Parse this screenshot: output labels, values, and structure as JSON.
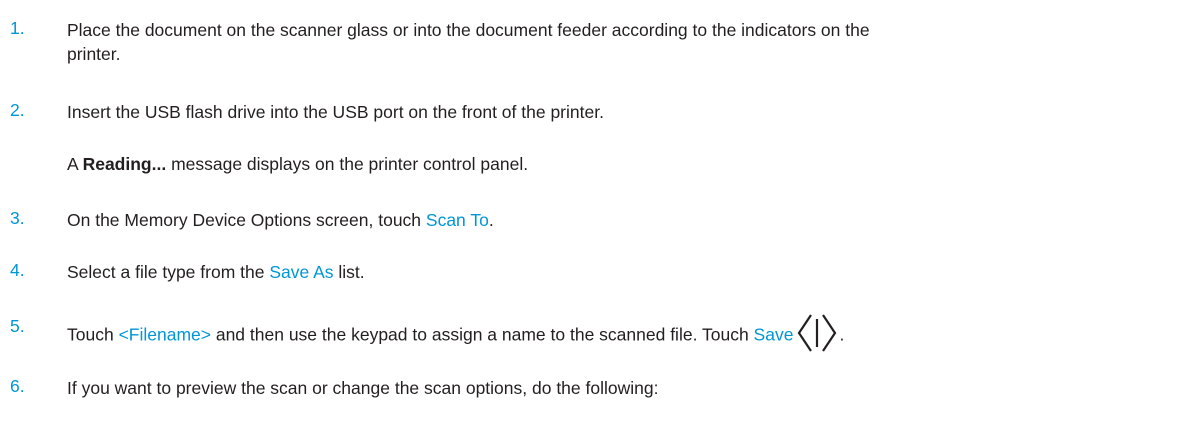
{
  "steps": [
    {
      "number": "1.",
      "text_line1": "Place the document on the scanner glass or into the document feeder according to the indicators on the",
      "text_line2": "printer."
    },
    {
      "number": "2.",
      "text": "Insert the USB flash drive into the USB port on the front of the printer.",
      "note_prefix": "A ",
      "note_bold": "Reading...",
      "note_suffix": " message displays on the printer control panel."
    },
    {
      "number": "3.",
      "text_prefix": "On the Memory Device Options screen, touch ",
      "ui_term": "Scan To",
      "text_suffix": "."
    },
    {
      "number": "4.",
      "text_prefix": "Select a file type from the ",
      "ui_term": "Save As",
      "text_suffix": " list."
    },
    {
      "number": "5.",
      "text_prefix": "Touch ",
      "ui_term1": "<Filename>",
      "text_middle": " and then use the keypad to assign a name to the scanned file. Touch ",
      "ui_term2": "Save",
      "icon": "start-button-icon",
      "text_suffix": "."
    },
    {
      "number": "6.",
      "text": "If you want to preview the scan or change the scan options, do the following:"
    }
  ],
  "colors": {
    "accent": "#0096d6",
    "text": "#231f20"
  }
}
